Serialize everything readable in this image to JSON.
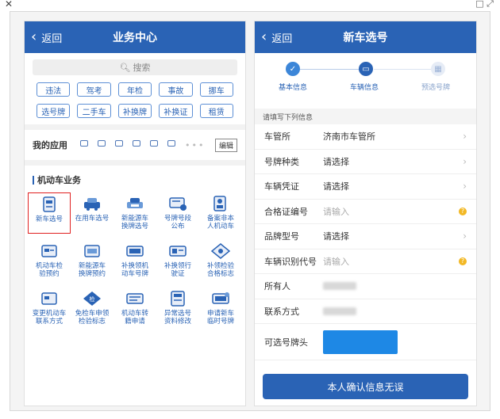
{
  "window": {
    "close": "✕",
    "restore": "□ ⤢"
  },
  "left": {
    "back_label": "返回",
    "title": "业务中心",
    "search_placeholder": "搜索",
    "tags": [
      "违法",
      "驾考",
      "年检",
      "事故",
      "挪车",
      "选号牌",
      "二手车",
      "补换牌",
      "补换证",
      "租赁"
    ],
    "my_apps_label": "我的应用",
    "my_apps_more": "•••",
    "edit_label": "编辑",
    "section_title": "机动车业务",
    "services": [
      [
        "新车选号"
      ],
      [
        "在用车选号"
      ],
      [
        "新能源车",
        "换牌选号"
      ],
      [
        "号牌号段",
        "公布"
      ],
      [
        "备案非本",
        "人机动车"
      ],
      [
        "机动车检",
        "验预约"
      ],
      [
        "新能源车",
        "换牌预约"
      ],
      [
        "补换领机",
        "动车号牌"
      ],
      [
        "补换领行",
        "驶证"
      ],
      [
        "补领检验",
        "合格标志"
      ],
      [
        "变更机动车",
        "联系方式"
      ],
      [
        "免检车申领",
        "检验标志"
      ],
      [
        "机动车转",
        "籍申请"
      ],
      [
        "异常选号",
        "资料修改"
      ],
      [
        "申请新车",
        "临时号牌"
      ]
    ]
  },
  "right": {
    "back_label": "返回",
    "title": "新车选号",
    "steps": [
      "基本信息",
      "车辆信息",
      "预选号牌"
    ],
    "hint": "请填写下列信息",
    "fields": [
      {
        "label": "车管所",
        "value": "济南市车管所"
      },
      {
        "label": "号牌种类",
        "value": "请选择"
      },
      {
        "label": "车辆凭证",
        "value": "请选择"
      },
      {
        "label": "合格证编号",
        "value": "请输入"
      },
      {
        "label": "品牌型号",
        "value": "请选择"
      },
      {
        "label": "车辆识别代号",
        "value": "请输入"
      },
      {
        "label": "所有人",
        "value": ""
      },
      {
        "label": "联系方式",
        "value": ""
      },
      {
        "label": "可选号牌头",
        "value": ""
      }
    ],
    "help_icon": "?",
    "confirm_label": "本人确认信息无误"
  },
  "colors": {
    "primary": "#2a63b5",
    "plate": "#1e88e5",
    "warn": "#f2b824",
    "selected_border": "#e02020"
  }
}
